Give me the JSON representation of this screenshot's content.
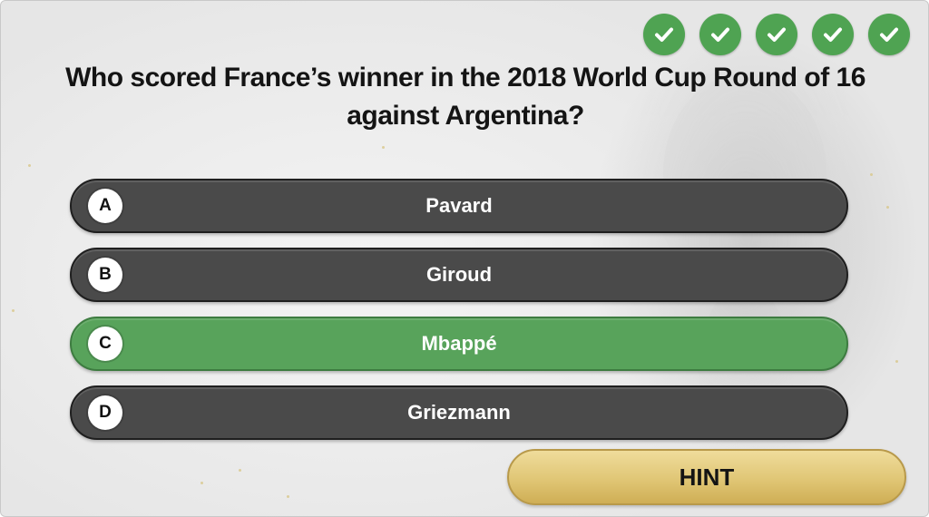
{
  "progress": {
    "checks": [
      "check-icon",
      "check-icon",
      "check-icon",
      "check-icon",
      "check-icon"
    ],
    "color": "#4fa352"
  },
  "question": {
    "line1": "Who scored France’s winner in the 2018 World Cup Round of 16",
    "line2": "against Argentina?"
  },
  "answers": [
    {
      "letter": "A",
      "text": "Pavard",
      "state": "default"
    },
    {
      "letter": "B",
      "text": "Giroud",
      "state": "default"
    },
    {
      "letter": "C",
      "text": "Mbappé",
      "state": "correct"
    },
    {
      "letter": "D",
      "text": "Griezmann",
      "state": "default"
    }
  ],
  "hint": {
    "label": "HINT"
  },
  "colors": {
    "answer_default": "#4a4a4a",
    "answer_correct": "#58a35b",
    "hint_gold": "#e0c675"
  }
}
